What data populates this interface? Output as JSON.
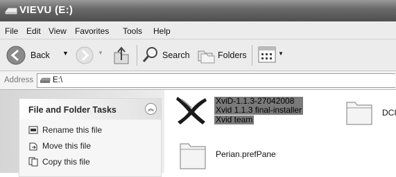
{
  "window": {
    "title": "VIEVU (E:)"
  },
  "menu": [
    "File",
    "Edit",
    "View",
    "Favorites",
    "Tools",
    "Help"
  ],
  "toolbar": {
    "back": "Back",
    "search": "Search",
    "folders": "Folders"
  },
  "address": {
    "label": "Address",
    "value": "E:\\"
  },
  "tasks": {
    "title": "File and Folder Tasks",
    "items": [
      "Rename this file",
      "Move this file",
      "Copy this file"
    ]
  },
  "files": {
    "xvid": {
      "line1": "XviD-1.1.3-27042008",
      "line2": "Xvid 1.1.3 final-installer",
      "line3": "Xvid team"
    },
    "perian": {
      "name": "Perian.prefPane"
    },
    "dci": {
      "name": "DCI"
    }
  }
}
